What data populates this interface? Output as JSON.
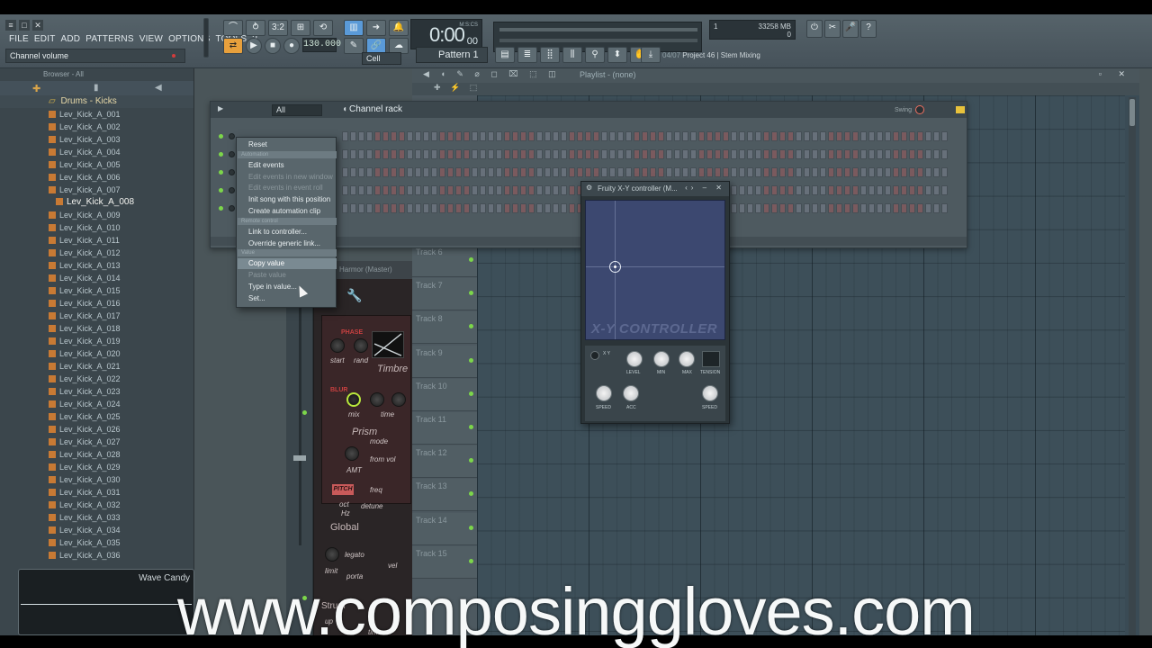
{
  "app": {
    "menu": [
      "FILE",
      "EDIT",
      "ADD",
      "PATTERNS",
      "VIEW",
      "OPTIONS",
      "TOOLS",
      "?"
    ],
    "hint": "Channel volume",
    "tempo": "130.000",
    "time": "0:00",
    "time_ms": "00",
    "time_unit": "M:S:CS",
    "pattern": "Pattern 1",
    "record_mode": "Cell",
    "cpu": {
      "a": "1",
      "b": "33258 MB",
      "c": "0"
    },
    "project_hint_date": "04/07",
    "project_hint_name": "Project 46 | Stem Mixing I"
  },
  "browser": {
    "title": "Browser - All",
    "folder": "Drums - Kicks",
    "files": [
      "Lev_Kick_A_001",
      "Lev_Kick_A_002",
      "Lev_Kick_A_003",
      "Lev_Kick_A_004",
      "Lev_Kick_A_005",
      "Lev_Kick_A_006",
      "Lev_Kick_A_007",
      "Lev_Kick_A_008",
      "Lev_Kick_A_009",
      "Lev_Kick_A_010",
      "Lev_Kick_A_011",
      "Lev_Kick_A_012",
      "Lev_Kick_A_013",
      "Lev_Kick_A_014",
      "Lev_Kick_A_015",
      "Lev_Kick_A_016",
      "Lev_Kick_A_017",
      "Lev_Kick_A_018",
      "Lev_Kick_A_019",
      "Lev_Kick_A_020",
      "Lev_Kick_A_021",
      "Lev_Kick_A_022",
      "Lev_Kick_A_023",
      "Lev_Kick_A_024",
      "Lev_Kick_A_025",
      "Lev_Kick_A_026",
      "Lev_Kick_A_027",
      "Lev_Kick_A_028",
      "Lev_Kick_A_029",
      "Lev_Kick_A_030",
      "Lev_Kick_A_031",
      "Lev_Kick_A_032",
      "Lev_Kick_A_033",
      "Lev_Kick_A_034",
      "Lev_Kick_A_035",
      "Lev_Kick_A_036"
    ],
    "selected_file": "Lev_Kick_A_008",
    "wave_candy": "Wave Candy"
  },
  "playlist": {
    "title": "Playlist - (none)",
    "tracks": [
      "Track 6",
      "Track 7",
      "Track 8",
      "Track 9",
      "Track 10",
      "Track 11",
      "Track 12",
      "Track 13",
      "Track 14",
      "Track 15"
    ]
  },
  "channel_rack": {
    "title": "Channel rack",
    "filter": "All",
    "swing_label": "Swing"
  },
  "context_menu": {
    "items": [
      {
        "label": "Reset",
        "type": "item"
      },
      {
        "label": "Automation",
        "type": "section"
      },
      {
        "label": "Edit events",
        "type": "item"
      },
      {
        "label": "Edit events in new window",
        "type": "disabled"
      },
      {
        "label": "Edit events in event roll",
        "type": "disabled"
      },
      {
        "label": "Init song with this position",
        "type": "item"
      },
      {
        "label": "Create automation clip",
        "type": "item"
      },
      {
        "label": "Remote control",
        "type": "section"
      },
      {
        "label": "Link to controller...",
        "type": "item"
      },
      {
        "label": "Override generic link...",
        "type": "item"
      },
      {
        "label": "Value",
        "type": "section"
      },
      {
        "label": "Copy value",
        "type": "highlight"
      },
      {
        "label": "Paste value",
        "type": "disabled"
      },
      {
        "label": "Type in value...",
        "type": "item"
      },
      {
        "label": "Set...",
        "type": "item"
      }
    ]
  },
  "plugin": {
    "header": "Harmor (Master)",
    "phase": "PHASE",
    "start": "start",
    "rand": "rand",
    "timbre": "Timbre",
    "blur": "BLUR",
    "mix": "mix",
    "time": "time",
    "prism": "Prism",
    "mode": "mode",
    "from_vol": "from vol",
    "amt": "AMT",
    "pitch": "PITCH",
    "freq": "freq",
    "oct": "oct",
    "hz": "Hz",
    "detune": "detune",
    "global": "Global",
    "legato": "legato",
    "limit": "limit",
    "vel": "vel",
    "porta": "porta",
    "strum": "Strum",
    "up": "up",
    "strum_time": "time"
  },
  "xy_controller": {
    "title": "Fruity X-Y controller (M...",
    "logo": "X-Y CONTROLLER",
    "xy_label": "X Y",
    "knobs": [
      "LEVEL",
      "MIN",
      "MAX",
      "TENSION"
    ],
    "speed_left": "SPEED",
    "acc": "ACC",
    "speed_right": "SPEED"
  },
  "watermark": "www.composinggloves.com"
}
